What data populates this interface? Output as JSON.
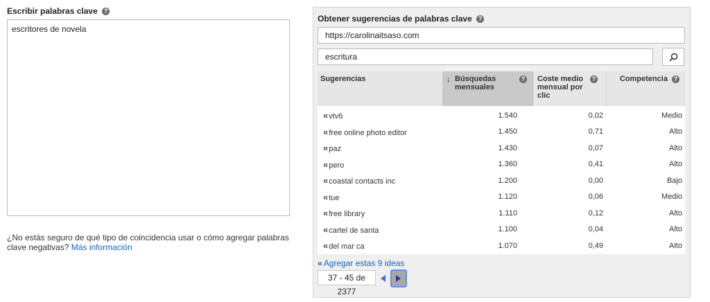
{
  "left": {
    "title": "Escribir palabras clave",
    "keywords_value": "escritores de novela",
    "help_text": "¿No estás seguro de qué tipo de coincidencia usar o cómo agregar palabras clave negativas?",
    "help_link": "Más información"
  },
  "right": {
    "title": "Obtener sugerencias de palabras clave",
    "url_value": "https://carolinaitsaso.com",
    "keyword_value": "escritura",
    "table": {
      "headers": {
        "suggestions": "Sugerencias",
        "searches": "Búsquedas mensuales",
        "cpc": "Coste medio mensual por clic",
        "competition": "Competencia"
      },
      "rows": [
        {
          "term": "vtv6",
          "searches": "1.540",
          "cpc": "0,02",
          "competition": "Medio"
        },
        {
          "term": "free online photo editor",
          "searches": "1.450",
          "cpc": "0,71",
          "competition": "Alto"
        },
        {
          "term": "paz",
          "searches": "1.430",
          "cpc": "0,07",
          "competition": "Alto"
        },
        {
          "term": "pero",
          "searches": "1.360",
          "cpc": "0,41",
          "competition": "Alto"
        },
        {
          "term": "coastal contacts inc",
          "searches": "1.200",
          "cpc": "0,00",
          "competition": "Bajo"
        },
        {
          "term": "tue",
          "searches": "1.120",
          "cpc": "0,06",
          "competition": "Medio"
        },
        {
          "term": "free library",
          "searches": "1.110",
          "cpc": "0,12",
          "competition": "Alto"
        },
        {
          "term": "cartel de santa",
          "searches": "1.100",
          "cpc": "0,04",
          "competition": "Alto"
        },
        {
          "term": "del mar ca",
          "searches": "1.070",
          "cpc": "0,49",
          "competition": "Alto"
        }
      ]
    },
    "add_ideas": "Agregar estas 9 ideas",
    "pager": "37 - 45 de 2377"
  },
  "colors": {
    "link": "#1565c0",
    "header_bg": "#e6e6e6",
    "sorted_header_bg": "#c9c9c9",
    "panel_bg": "#efefef"
  },
  "icons": [
    "help-icon",
    "search-icon",
    "add-chevron-icon",
    "sort-down-arrow-icon",
    "prev-arrow-icon",
    "next-arrow-icon"
  ]
}
